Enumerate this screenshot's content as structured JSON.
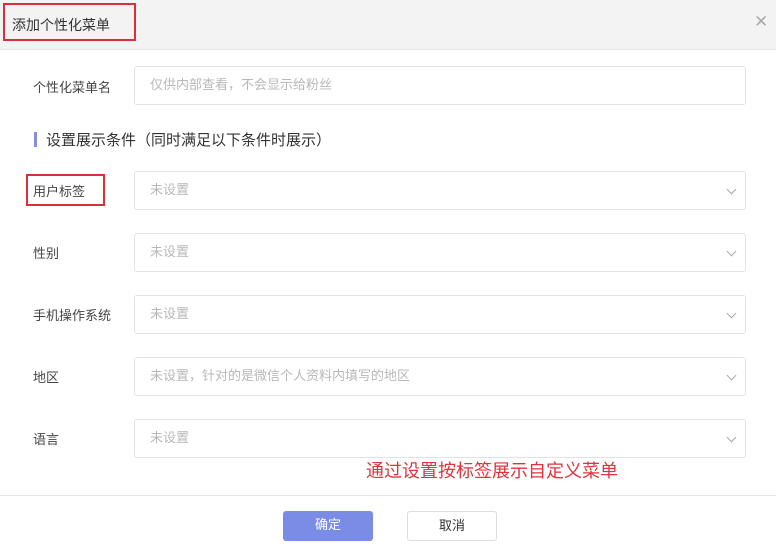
{
  "dialog": {
    "title": "添加个性化菜单",
    "close_icon": "close-icon"
  },
  "name_field": {
    "label": "个性化菜单名",
    "placeholder": "仅供内部查看，不会显示给粉丝"
  },
  "section_title": "设置展示条件（同时满足以下条件时展示）",
  "conditions": [
    {
      "label": "用户标签",
      "placeholder": "未设置"
    },
    {
      "label": "性别",
      "placeholder": "未设置"
    },
    {
      "label": "手机操作系统",
      "placeholder": "未设置"
    },
    {
      "label": "地区",
      "placeholder": "未设置，针对的是微信个人资料内填写的地区"
    },
    {
      "label": "语言",
      "placeholder": "未设置"
    }
  ],
  "annotation": "通过设置按标签展示自定义菜单",
  "footer": {
    "confirm": "确定",
    "cancel": "取消"
  },
  "colors": {
    "primary": "#7b8ce6",
    "highlight": "#d9303a"
  }
}
